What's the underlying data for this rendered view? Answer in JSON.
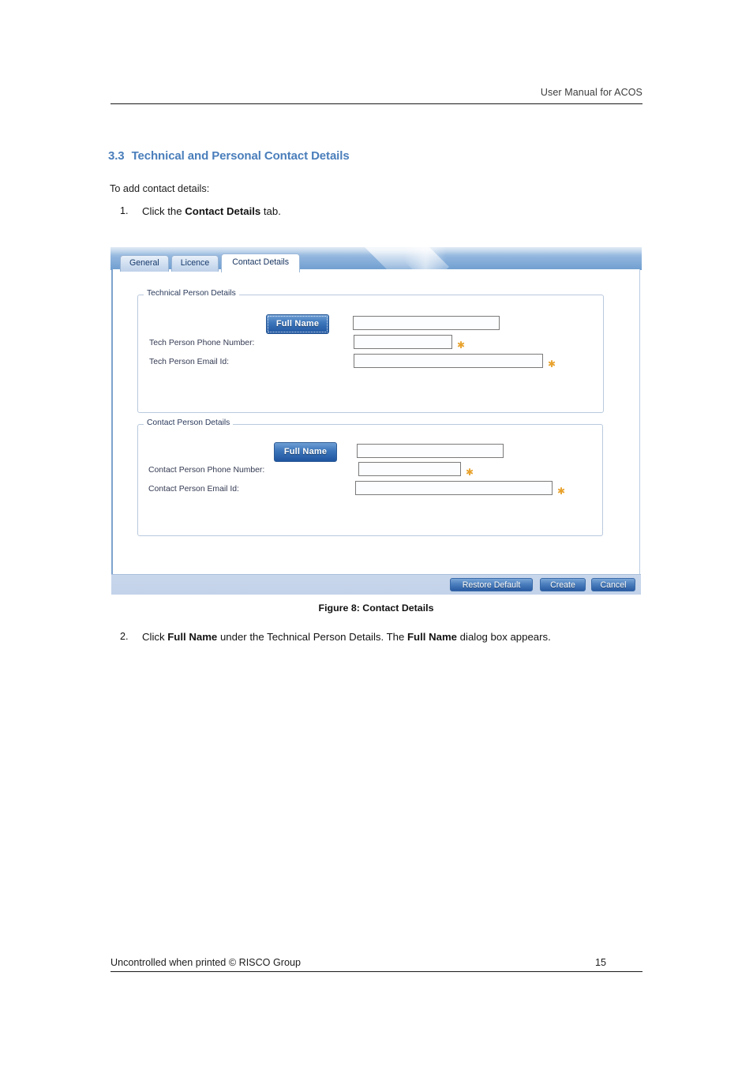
{
  "page": {
    "header_text": "User Manual for ACOS",
    "footer_left": "Uncontrolled when printed © RISCO Group",
    "footer_page_number": "15"
  },
  "section": {
    "number": "3.3",
    "title": "Technical and Personal Contact Details",
    "intro": "To add contact details:"
  },
  "steps": [
    {
      "marker": "1.",
      "before": "Click the ",
      "bold": "Contact Details",
      "after": " tab."
    },
    {
      "marker": "2.",
      "before": "Click ",
      "bold": "Full Name",
      "middle": " under the Technical Person Details. The ",
      "bold2": "Full Name",
      "after": " dialog box appears."
    }
  ],
  "figure": {
    "caption": "Figure 8: Contact Details",
    "tabs": [
      {
        "label": "General",
        "active": false
      },
      {
        "label": "Licence",
        "active": false
      },
      {
        "label": "Contact Details",
        "active": true
      }
    ],
    "groups": [
      {
        "legend": "Technical Person Details",
        "fullname_button": "Full Name",
        "phone_label": "Tech Person Phone Number:",
        "phone_value": "",
        "email_label": "Tech Person Email Id:",
        "email_value": "",
        "name_value": "",
        "required_marker": "✱"
      },
      {
        "legend": "Contact Person Details",
        "fullname_button": "Full Name",
        "phone_label": "Contact Person Phone Number:",
        "phone_value": "",
        "email_label": "Contact Person Email Id:",
        "email_value": "",
        "name_value": "",
        "required_marker": "✱"
      }
    ],
    "actions": {
      "restore_default": "Restore Default",
      "create": "Create",
      "cancel": "Cancel"
    },
    "colors": {
      "banner_blue": "#8fb4dd",
      "button_blue": "#2a5ca3",
      "tab_text": "#15386b",
      "required_orange": "#e8a22c",
      "heading_blue": "#4a7ebb",
      "footer_bar": "#c6d4ea"
    }
  }
}
